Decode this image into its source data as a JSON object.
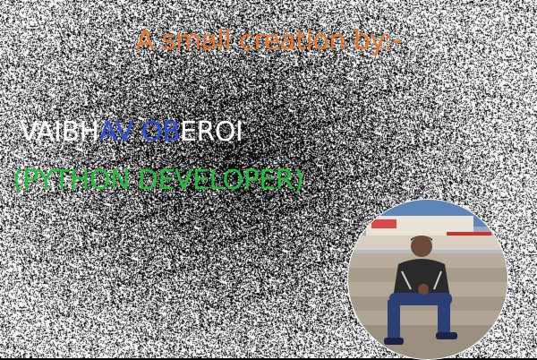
{
  "tagline": "A small creation by:-",
  "name_parts": [
    "VAIBH",
    "AV",
    " ",
    "OB",
    "EROI"
  ],
  "role": "(PYTHON DEVELOPER)",
  "colors": {
    "background": "#0a0a0a",
    "tagline": "#e8742a",
    "name": "#ffffff",
    "name_accent": "#2f4fd8",
    "role": "#1fbf3a"
  },
  "photo": {
    "alt": "Circular portrait photo of a man sitting on stairs"
  }
}
